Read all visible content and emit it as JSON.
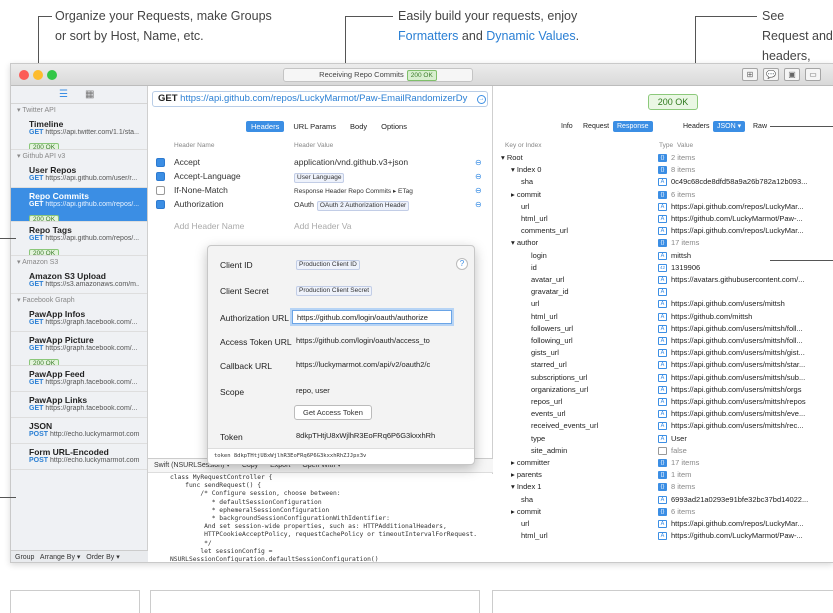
{
  "callouts": {
    "left": {
      "l1": "Organize your Requests, make Groups",
      "l2": "or sort by Host, Name, etc."
    },
    "mid": {
      "l1": "Easily build your requests, enjoy",
      "l2a": "Formatters",
      "l2b": " and ",
      "l2c": "Dynamic Values",
      "l2d": "."
    },
    "right": {
      "l1": "See Request and",
      "l2": "headers, and bo"
    }
  },
  "titlebar": {
    "status": "Receiving Repo Commits",
    "badge": "200 OK",
    "icons": [
      "split-icon",
      "chat-icon",
      "image-icon",
      "window-icon"
    ]
  },
  "sidebar": {
    "groups": [
      {
        "name": "▾ Twitter API",
        "items": [
          {
            "name": "Timeline",
            "method": "GET",
            "url": "https://api.twitter.com/1.1/sta...",
            "badge": "200 OK"
          }
        ]
      },
      {
        "name": "▾ Github API v3",
        "items": [
          {
            "name": "User Repos",
            "method": "GET",
            "url": "https://api.github.com/user/r..."
          },
          {
            "name": "Repo Commits",
            "method": "GET",
            "url": "https://api.github.com/repos/...",
            "badge": "200 OK",
            "selected": true
          },
          {
            "name": "Repo Tags",
            "method": "GET",
            "url": "https://api.github.com/repos/...",
            "badge": "200 OK"
          }
        ]
      },
      {
        "name": "▾ Amazon S3",
        "items": [
          {
            "name": "Amazon S3 Upload",
            "method": "GET",
            "url": "https://s3.amazonaws.com/m..."
          }
        ]
      },
      {
        "name": "▾ Facebook Graph",
        "items": [
          {
            "name": "PawApp Infos",
            "method": "GET",
            "url": "https://graph.facebook.com/..."
          },
          {
            "name": "PawApp Picture",
            "method": "GET",
            "url": "https://graph.facebook.com/...",
            "badge": "200 OK"
          },
          {
            "name": "PawApp Feed",
            "method": "GET",
            "url": "https://graph.facebook.com/..."
          },
          {
            "name": "PawApp Links",
            "method": "GET",
            "url": "https://graph.facebook.com/..."
          }
        ]
      },
      {
        "name": "",
        "items": [
          {
            "name": "JSON",
            "method": "POST",
            "url": "http://echo.luckymarmot.com"
          },
          {
            "name": "Form URL-Encoded",
            "method": "POST",
            "url": "http://echo.luckymarmot.com"
          }
        ]
      }
    ],
    "footer": [
      "Group",
      "Arrange By ▾",
      "Order By ▾"
    ]
  },
  "request": {
    "method": "GET",
    "url": "https://api.github.com/repos/LuckyMarmot/Paw-EmailRandomizerDy",
    "tabs": [
      "Headers",
      "URL Params",
      "Body",
      "Options"
    ],
    "col_name": "Header Name",
    "col_value": "Header Value",
    "headers": [
      {
        "name": "Accept",
        "value": "application/vnd.github.v3+json",
        "checked": true
      },
      {
        "name": "Accept-Language",
        "value": "User Language",
        "token": true,
        "checked": true
      },
      {
        "name": "If-None-Match",
        "value": "Response Header Repo Commits ▸ ETag",
        "checked": false
      },
      {
        "name": "Authorization",
        "value": "OAuth 2 Authorization Header",
        "prefix": "OAuth",
        "token": true,
        "checked": true
      }
    ],
    "add_name": "Add Header Name",
    "add_value": "Add Header Va"
  },
  "oauth": {
    "client_id_label": "Client ID",
    "client_id": "Production Client ID",
    "client_secret_label": "Client Secret",
    "client_secret": "Production Client Secret",
    "auth_url_label": "Authorization URL",
    "auth_url": "https://github.com/login/oauth/authorize",
    "token_url_label": "Access Token URL",
    "token_url": "https://github.com/login/oauth/access_to",
    "callback_label": "Callback URL",
    "callback": "https://luckymarmot.com/api/v2/oauth2/c",
    "scope_label": "Scope",
    "scope": "repo, user",
    "get_token": "Get Access Token",
    "token_label": "Token",
    "token": "8dkpTHtjU8xWjlhR3EoFRq6P6G3kxxhRh",
    "token_line": "token 8dkpTHtjU8xWjlhR3EoFRq6P6G3kxxhRhZJJpx3v",
    "help": "?"
  },
  "code": {
    "toolbar": [
      "Swift (NSURLSession) ▾",
      "Copy",
      "Export",
      "Open With ▾"
    ],
    "text": "class MyRequestController {\n    func sendRequest() {\n        /* Configure session, choose between:\n           * defaultSessionConfiguration\n           * ephemeralSessionConfiguration\n           * backgroundSessionConfigurationWithIdentifier:\n         And set session-wide properties, such as: HTTPAdditionalHeaders,\n         HTTPCookieAcceptPolicy, requestCachePolicy or timeoutIntervalForRequest.\n         */\n        let sessionConfig =\nNSURLSessionConfiguration.defaultSessionConfiguration()"
  },
  "response": {
    "status": "200 OK",
    "tabs_left": [
      "Info",
      "Request",
      "Response"
    ],
    "tabs_right": [
      "Headers",
      "JSON ▾",
      "Raw"
    ],
    "col_key": "Key or Index",
    "col_type": "Type",
    "col_value": "Value",
    "rows": [
      {
        "k": "▾ Root",
        "lvl": 0,
        "t": "o",
        "ts": "{}",
        "v": "2 items",
        "g": true
      },
      {
        "k": "▾ Index 0",
        "lvl": 1,
        "t": "o",
        "ts": "{}",
        "v": "8 items",
        "g": true
      },
      {
        "k": "sha",
        "lvl": 2,
        "t": "s",
        "ts": "A",
        "v": "0c49c68cde8dfd58a9a26b782a12b093..."
      },
      {
        "k": "▸ commit",
        "lvl": 1,
        "t": "o",
        "ts": "{}",
        "v": "6 items",
        "g": true
      },
      {
        "k": "url",
        "lvl": 2,
        "t": "s",
        "ts": "A",
        "v": "https://api.github.com/repos/LuckyMar..."
      },
      {
        "k": "html_url",
        "lvl": 2,
        "t": "s",
        "ts": "A",
        "v": "https://github.com/LuckyMarmot/Paw-..."
      },
      {
        "k": "comments_url",
        "lvl": 2,
        "t": "s",
        "ts": "A",
        "v": "https://api.github.com/repos/LuckyMar..."
      },
      {
        "k": "▾ author",
        "lvl": 1,
        "t": "o",
        "ts": "{}",
        "v": "17 items",
        "g": true
      },
      {
        "k": "login",
        "lvl": 3,
        "t": "s",
        "ts": "A",
        "v": "mittsh"
      },
      {
        "k": "id",
        "lvl": 3,
        "t": "n",
        "ts": "42",
        "v": "1319906"
      },
      {
        "k": "avatar_url",
        "lvl": 3,
        "t": "s",
        "ts": "A",
        "v": "https://avatars.githubusercontent.com/..."
      },
      {
        "k": "gravatar_id",
        "lvl": 3,
        "t": "s",
        "ts": "A",
        "v": ""
      },
      {
        "k": "url",
        "lvl": 3,
        "t": "s",
        "ts": "A",
        "v": "https://api.github.com/users/mittsh"
      },
      {
        "k": "html_url",
        "lvl": 3,
        "t": "s",
        "ts": "A",
        "v": "https://github.com/mittsh"
      },
      {
        "k": "followers_url",
        "lvl": 3,
        "t": "s",
        "ts": "A",
        "v": "https://api.github.com/users/mittsh/foll..."
      },
      {
        "k": "following_url",
        "lvl": 3,
        "t": "s",
        "ts": "A",
        "v": "https://api.github.com/users/mittsh/foll..."
      },
      {
        "k": "gists_url",
        "lvl": 3,
        "t": "s",
        "ts": "A",
        "v": "https://api.github.com/users/mittsh/gist..."
      },
      {
        "k": "starred_url",
        "lvl": 3,
        "t": "s",
        "ts": "A",
        "v": "https://api.github.com/users/mittsh/star..."
      },
      {
        "k": "subscriptions_url",
        "lvl": 3,
        "t": "s",
        "ts": "A",
        "v": "https://api.github.com/users/mittsh/sub..."
      },
      {
        "k": "organizations_url",
        "lvl": 3,
        "t": "s",
        "ts": "A",
        "v": "https://api.github.com/users/mittsh/orgs"
      },
      {
        "k": "repos_url",
        "lvl": 3,
        "t": "s",
        "ts": "A",
        "v": "https://api.github.com/users/mittsh/repos"
      },
      {
        "k": "events_url",
        "lvl": 3,
        "t": "s",
        "ts": "A",
        "v": "https://api.github.com/users/mittsh/eve..."
      },
      {
        "k": "received_events_url",
        "lvl": 3,
        "t": "s",
        "ts": "A",
        "v": "https://api.github.com/users/mittsh/rec..."
      },
      {
        "k": "type",
        "lvl": 3,
        "t": "s",
        "ts": "A",
        "v": "User"
      },
      {
        "k": "site_admin",
        "lvl": 3,
        "t": "b",
        "ts": "",
        "v": "false",
        "g": true
      },
      {
        "k": "▸ committer",
        "lvl": 1,
        "t": "o",
        "ts": "{}",
        "v": "17 items",
        "g": true
      },
      {
        "k": "▸ parents",
        "lvl": 1,
        "t": "o",
        "ts": "[]",
        "v": "1 item",
        "g": true
      },
      {
        "k": "▾ Index 1",
        "lvl": 1,
        "t": "o",
        "ts": "{}",
        "v": "8 items",
        "g": true
      },
      {
        "k": "sha",
        "lvl": 2,
        "t": "s",
        "ts": "A",
        "v": "6993ad21a0293e91bfe32bc37bd14022..."
      },
      {
        "k": "▸ commit",
        "lvl": 1,
        "t": "o",
        "ts": "{}",
        "v": "6 items",
        "g": true
      },
      {
        "k": "url",
        "lvl": 2,
        "t": "s",
        "ts": "A",
        "v": "https://api.github.com/repos/LuckyMar..."
      },
      {
        "k": "html_url",
        "lvl": 2,
        "t": "s",
        "ts": "A",
        "v": "https://github.com/LuckyMarmot/Paw-..."
      }
    ]
  }
}
